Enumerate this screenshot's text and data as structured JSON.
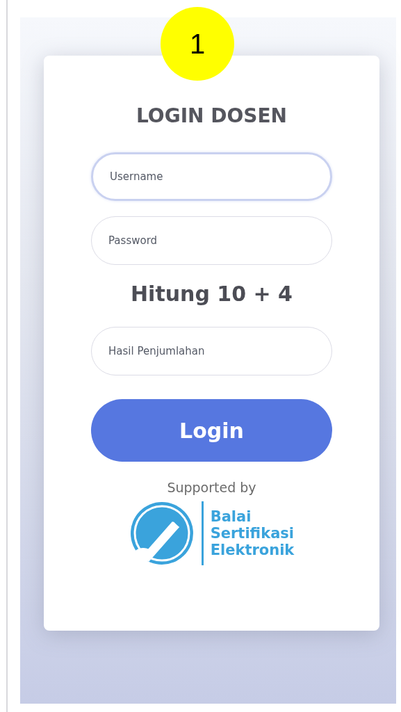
{
  "marker": "1",
  "title": "LOGIN DOSEN",
  "fields": [
    {
      "placeholder": "Username",
      "focused": true
    },
    {
      "placeholder": "Password",
      "focused": false
    }
  ],
  "captcha_question": "Hitung 10 + 4",
  "captcha_field": {
    "placeholder": "Hasil Penjumlahan",
    "focused": false
  },
  "login_button": "Login",
  "supported_by": "Supported by",
  "logo_lines": [
    "Balai",
    "Sertifikasi",
    "Elektronik"
  ]
}
